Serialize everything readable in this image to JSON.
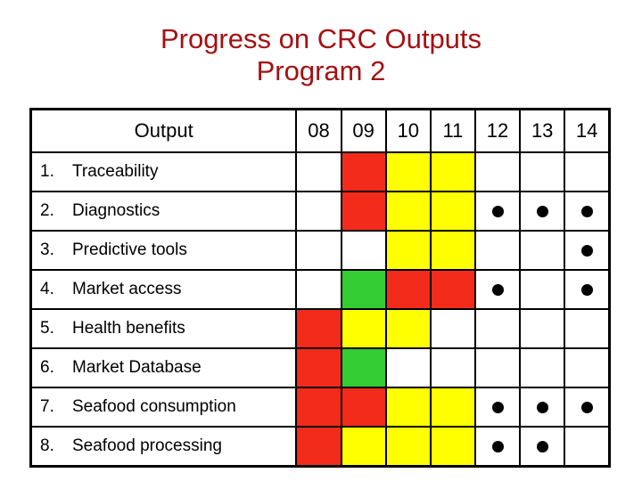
{
  "slide": {
    "title_line1": "Progress on CRC Outputs",
    "title_line2": "Program 2",
    "title_color": "#a51013",
    "background": "#ffffff"
  },
  "table": {
    "header": {
      "output_label": "Output",
      "years": [
        "08",
        "09",
        "10",
        "11",
        "12",
        "13",
        "14"
      ]
    },
    "legend_colors": {
      "red": "#f32b1a",
      "yellow": "#ffff00",
      "green": "#33cc33",
      "white": "#ffffff",
      "dot": "#000000"
    },
    "rows": [
      {
        "number": "1.",
        "label": "Traceability",
        "cells": [
          {
            "color": "white",
            "dot": false
          },
          {
            "color": "red",
            "dot": false
          },
          {
            "color": "yellow",
            "dot": false
          },
          {
            "color": "yellow",
            "dot": false
          },
          {
            "color": "white",
            "dot": false
          },
          {
            "color": "white",
            "dot": false
          },
          {
            "color": "white",
            "dot": false
          }
        ]
      },
      {
        "number": "2.",
        "label": "Diagnostics",
        "cells": [
          {
            "color": "white",
            "dot": false
          },
          {
            "color": "red",
            "dot": false
          },
          {
            "color": "yellow",
            "dot": false
          },
          {
            "color": "yellow",
            "dot": false
          },
          {
            "color": "white",
            "dot": true
          },
          {
            "color": "white",
            "dot": true
          },
          {
            "color": "white",
            "dot": true
          }
        ]
      },
      {
        "number": "3.",
        "label": "Predictive tools",
        "cells": [
          {
            "color": "white",
            "dot": false
          },
          {
            "color": "white",
            "dot": false
          },
          {
            "color": "yellow",
            "dot": false
          },
          {
            "color": "yellow",
            "dot": false
          },
          {
            "color": "white",
            "dot": false
          },
          {
            "color": "white",
            "dot": false
          },
          {
            "color": "white",
            "dot": true
          }
        ]
      },
      {
        "number": "4.",
        "label": "Market access",
        "cells": [
          {
            "color": "white",
            "dot": false
          },
          {
            "color": "green",
            "dot": false
          },
          {
            "color": "red",
            "dot": false
          },
          {
            "color": "red",
            "dot": false
          },
          {
            "color": "white",
            "dot": true
          },
          {
            "color": "white",
            "dot": false
          },
          {
            "color": "white",
            "dot": true
          }
        ]
      },
      {
        "number": "5.",
        "label": "Health benefits",
        "cells": [
          {
            "color": "red",
            "dot": false
          },
          {
            "color": "yellow",
            "dot": false
          },
          {
            "color": "yellow",
            "dot": false
          },
          {
            "color": "white",
            "dot": false
          },
          {
            "color": "white",
            "dot": false
          },
          {
            "color": "white",
            "dot": false
          },
          {
            "color": "white",
            "dot": false
          }
        ]
      },
      {
        "number": "6.",
        "label": "Market Database",
        "cells": [
          {
            "color": "red",
            "dot": false
          },
          {
            "color": "green",
            "dot": false
          },
          {
            "color": "white",
            "dot": false
          },
          {
            "color": "white",
            "dot": false
          },
          {
            "color": "white",
            "dot": false
          },
          {
            "color": "white",
            "dot": false
          },
          {
            "color": "white",
            "dot": false
          }
        ]
      },
      {
        "number": "7.",
        "label": "Seafood consumption",
        "cells": [
          {
            "color": "red",
            "dot": false
          },
          {
            "color": "red",
            "dot": false
          },
          {
            "color": "yellow",
            "dot": false
          },
          {
            "color": "yellow",
            "dot": false
          },
          {
            "color": "white",
            "dot": true
          },
          {
            "color": "white",
            "dot": true
          },
          {
            "color": "white",
            "dot": true
          }
        ]
      },
      {
        "number": "8.",
        "label": "Seafood processing",
        "cells": [
          {
            "color": "red",
            "dot": false
          },
          {
            "color": "yellow",
            "dot": false
          },
          {
            "color": "yellow",
            "dot": false
          },
          {
            "color": "yellow",
            "dot": false
          },
          {
            "color": "white",
            "dot": true
          },
          {
            "color": "white",
            "dot": true
          },
          {
            "color": "white",
            "dot": false
          }
        ]
      }
    ]
  }
}
